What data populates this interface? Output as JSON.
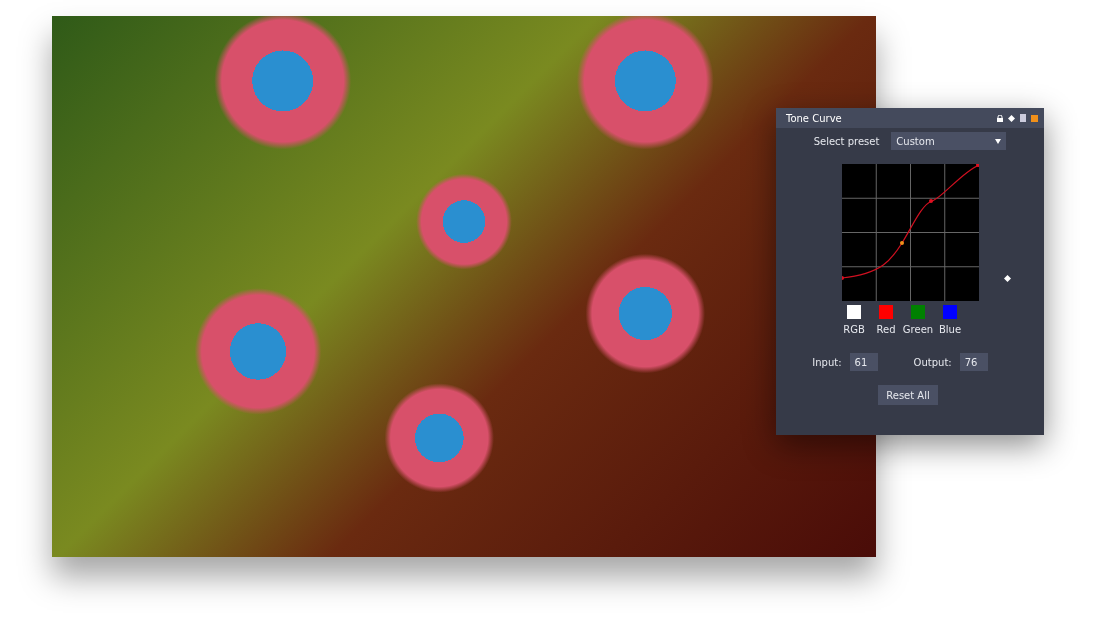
{
  "panel": {
    "title": "Tone Curve"
  },
  "preset": {
    "label": "Select preset",
    "value": "Custom"
  },
  "channels": [
    {
      "label": "RGB",
      "color": "#ffffff"
    },
    {
      "label": "Red",
      "color": "#ff0000"
    },
    {
      "label": "Green",
      "color": "#008000"
    },
    {
      "label": "Blue",
      "color": "#0000ff"
    }
  ],
  "input": {
    "label": "Input:",
    "value": "61"
  },
  "output": {
    "label": "Output:",
    "value": "76"
  },
  "buttons": [
    {
      "label": "Reset All"
    }
  ]
}
